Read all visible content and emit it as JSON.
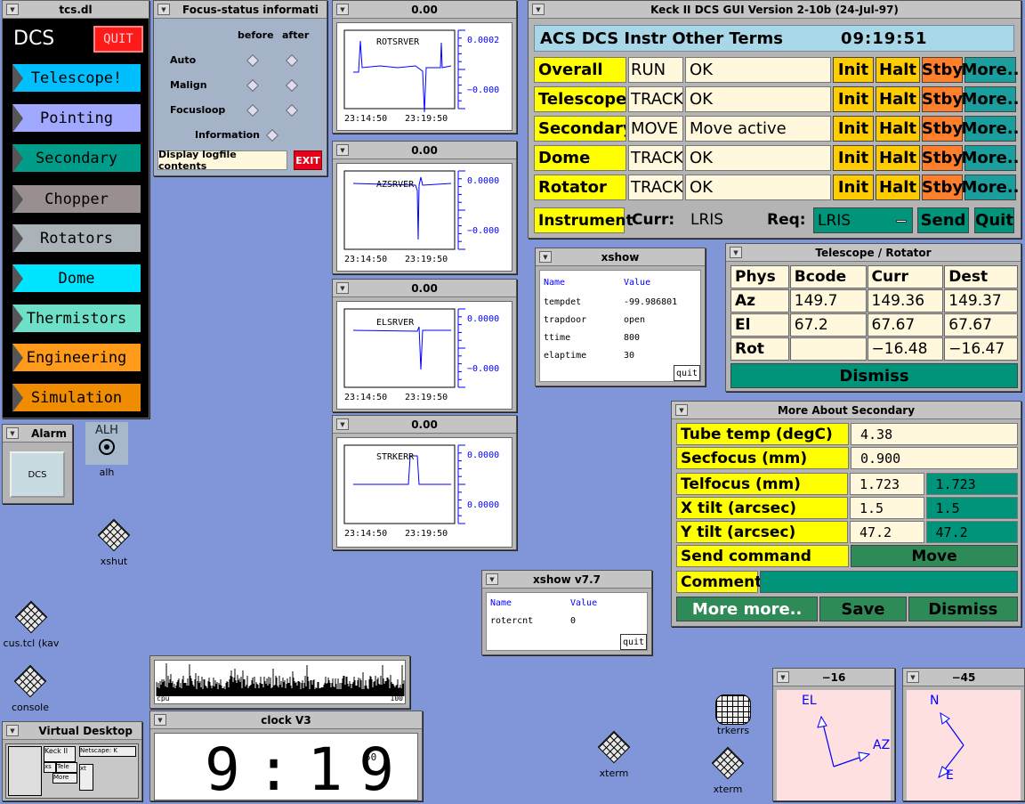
{
  "tcs": {
    "title": "tcs.dl",
    "logo": "DCS",
    "quit": "QUIT",
    "buttons": [
      {
        "label": "Telescope!",
        "bg": "#00bfff"
      },
      {
        "label": "Pointing",
        "bg": "#a0a8ff"
      },
      {
        "label": "Secondary",
        "bg": "#009e8a"
      },
      {
        "label": "Chopper",
        "bg": "#9a8f90"
      },
      {
        "label": "Rotators",
        "bg": "#a9b3b8"
      },
      {
        "label": "Dome",
        "bg": "#00e5ff"
      },
      {
        "label": "Thermistors",
        "bg": "#6fe0c8"
      },
      {
        "label": "Engineering",
        "bg": "#ff9a1a"
      },
      {
        "label": "Simulation",
        "bg": "#f08c00"
      }
    ]
  },
  "focus": {
    "title": "Focus-status informati",
    "col_before": "before",
    "col_after": "after",
    "rows": [
      "Auto",
      "Malign",
      "Focusloop"
    ],
    "info_label": "Information",
    "display_btn": "Display logfile contents",
    "exit_btn": "EXIT"
  },
  "plots": [
    {
      "title": "0.00",
      "label": "ROTSRVER",
      "y_hi": "0.0002",
      "y_lo": "−0.000",
      "t0": "23:14:50",
      "t1": "23:19:50"
    },
    {
      "title": "0.00",
      "label": "AZSRVER",
      "y_hi": "0.0000",
      "y_lo": "−0.000",
      "t0": "23:14:50",
      "t1": "23:19:50"
    },
    {
      "title": "0.00",
      "label": "ELSRVER",
      "y_hi": "0.0000",
      "y_lo": "−0.000",
      "t0": "23:14:50",
      "t1": "23:19:50"
    },
    {
      "title": "0.00",
      "label": "STRKERR",
      "y_hi": "0.0000",
      "y_lo": "0.0000",
      "t0": "23:14:50",
      "t1": "23:19:50"
    }
  ],
  "keck": {
    "title": "Keck II DCS GUI Version 2-10b (24-Jul-97)",
    "menu": "ACS DCS Instr Other Terms",
    "time": "09:19:51",
    "rows": [
      {
        "name": "Overall",
        "state": "RUN",
        "msg": "OK"
      },
      {
        "name": "Telescope",
        "state": "TRACK",
        "msg": "OK"
      },
      {
        "name": "Secondary",
        "state": "MOVE",
        "msg": "Move active"
      },
      {
        "name": "Dome",
        "state": "TRACK",
        "msg": "OK"
      },
      {
        "name": "Rotator",
        "state": "TRACK",
        "msg": "OK"
      }
    ],
    "init": "Init",
    "halt": "Halt",
    "stby": "Stby",
    "more": "More..",
    "instrument": "Instrument",
    "curr_label": "Curr:",
    "curr_val": "LRIS",
    "req_label": "Req:",
    "req_val": "LRIS",
    "send": "Send",
    "quit": "Quit"
  },
  "xshow1": {
    "title": "xshow",
    "h_name": "Name",
    "h_value": "Value",
    "rows": [
      [
        "tempdet",
        "-99.986801"
      ],
      [
        "trapdoor",
        "open"
      ],
      [
        "ttime",
        "800"
      ],
      [
        "elaptime",
        "30"
      ]
    ],
    "quit": "quit"
  },
  "telrot": {
    "title": "Telescope / Rotator",
    "headers": [
      "Phys",
      "Bcode",
      "Curr",
      "Dest"
    ],
    "rows": [
      [
        "Az",
        "149.7",
        "149.36",
        "149.37"
      ],
      [
        "El",
        "67.2",
        "67.67",
        "67.67"
      ],
      [
        "Rot",
        "",
        "−16.48",
        "−16.47"
      ]
    ],
    "dismiss": "Dismiss"
  },
  "secondary": {
    "title": "More About Secondary",
    "tube_label": "Tube temp (degC)",
    "tube_val": "4.38",
    "secf_label": "Secfocus (mm)",
    "secf_val": "0.900",
    "rows": [
      {
        "label": "Telfocus (mm)",
        "val": "1.723",
        "set": "1.723"
      },
      {
        "label": "X tilt (arcsec)",
        "val": "1.5",
        "set": "1.5"
      },
      {
        "label": "Y tilt (arcsec)",
        "val": "47.2",
        "set": "47.2"
      }
    ],
    "send_label": "Send command",
    "move": "Move",
    "comment_label": "Comment:",
    "more": "More more..",
    "save": "Save",
    "dismiss": "Dismiss"
  },
  "xshow2": {
    "title": "xshow v7.7",
    "h_name": "Name",
    "h_value": "Value",
    "rows": [
      [
        "rotercnt",
        "0"
      ]
    ],
    "quit": "quit"
  },
  "alarm": {
    "title": "Alarm",
    "btn": "DCS"
  },
  "alh": {
    "top": "ALH",
    "label": "alh"
  },
  "icons": {
    "xshut": "xshut",
    "cus": "cus.tcl (kav",
    "console": "console",
    "trkerrs": "trkerrs",
    "xterm1": "xterm",
    "xterm2": "xterm"
  },
  "cpu": {
    "left": "cpu",
    "right": "100"
  },
  "vdesk": {
    "title": "Virtual Desktop",
    "labels": [
      "Keck II",
      "Netscape: K",
      "xs",
      "Tele",
      "xt",
      "More"
    ]
  },
  "clock": {
    "title": "clock V3",
    "time": "9:19",
    "sec": "50"
  },
  "comp1": {
    "title": "−16",
    "labels": [
      "EL",
      "AZ"
    ]
  },
  "comp2": {
    "title": "−45",
    "labels": [
      "N",
      "E"
    ]
  }
}
